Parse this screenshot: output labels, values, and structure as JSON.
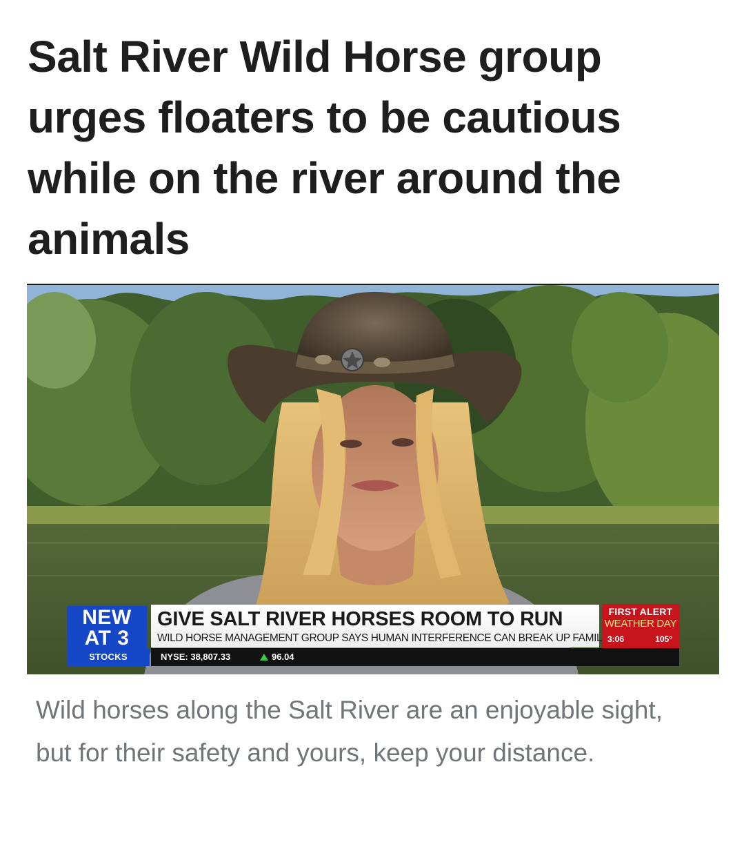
{
  "article": {
    "headline": "Salt River Wild Horse group urges floaters to be cautious while on the river around the animals",
    "caption": "Wild horses along the Salt River are an enjoyable sight, but for their safety and yours, keep your distance."
  },
  "broadcast": {
    "badge_line1": "NEW",
    "badge_line2": "AT 3",
    "title": "GIVE SALT RIVER HORSES ROOM TO RUN",
    "subtitle": "WILD HORSE MANAGEMENT GROUP SAYS HUMAN INTERFERENCE CAN BREAK UP FAMILIES",
    "alert_line1": "FIRST ALERT",
    "alert_line2": "WEATHER DAY",
    "time": "3:06",
    "temperature": "105°",
    "ticker_label": "STOCKS",
    "ticker_index": "NYSE: 38,807.33",
    "ticker_change": "96.04",
    "ticker_change_icon": "up-arrow-icon"
  },
  "colors": {
    "headline": "#1e1e1e",
    "caption": "#707579",
    "badge_blue": "#1547c6",
    "alert_red": "#c8141c",
    "alert_yellow": "#ffe38a",
    "ticker_up_green": "#3cc84a"
  }
}
